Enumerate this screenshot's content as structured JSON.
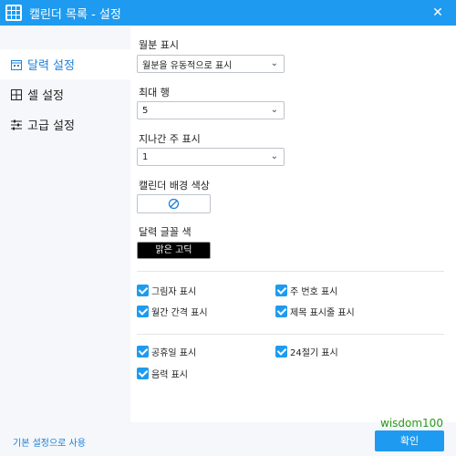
{
  "window": {
    "title": "캘린더 목록 - 설정",
    "close": "✕"
  },
  "sidebar": {
    "items": [
      {
        "label": "달력 설정",
        "active": true,
        "icon": "calendar-icon"
      },
      {
        "label": "셀 설정",
        "active": false,
        "icon": "grid-icon"
      },
      {
        "label": "고급 설정",
        "active": false,
        "icon": "sliders-icon"
      }
    ],
    "reset_link": "기본 설정으로 사용"
  },
  "settings": {
    "month_display": {
      "label": "월분 표시",
      "value": "월분을 유동적으로 표시"
    },
    "max_rows": {
      "label": "최대 행",
      "value": "5"
    },
    "past_weeks": {
      "label": "지나간 주 표시",
      "value": "1"
    },
    "bg_color": {
      "label": "캘린더 배경 색상"
    },
    "font_color": {
      "label": "달력 글꼴 색",
      "value": "맑은 고딕"
    }
  },
  "checks": {
    "shadow": "그림자 표시",
    "week_number": "주 번호 표시",
    "month_gap": "월간 간격 표시",
    "title_show": "제목 표시줄 표시",
    "holiday": "공휴일 표시",
    "solar_terms": "24절기 표시",
    "lunar": "음력 표시"
  },
  "footer": {
    "ok": "확인"
  },
  "watermark": "wisdom100",
  "colors": {
    "accent": "#1e9bf0",
    "sidebar_bg": "#f5f7fa",
    "link": "#1e7fd8"
  }
}
